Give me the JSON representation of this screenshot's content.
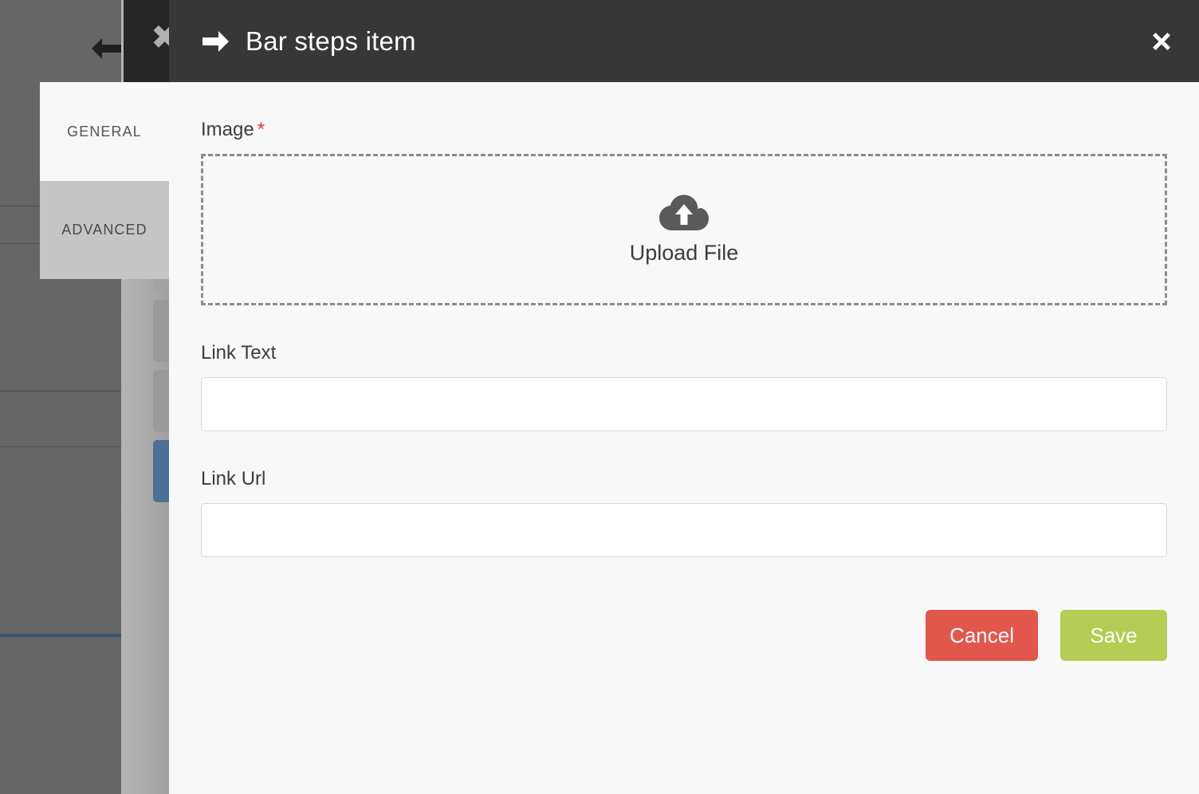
{
  "background": {
    "back_arrow_icon": "arrow-left-icon",
    "partial_glyph": "✖",
    "panel_color": "#666666",
    "strip_color": "#aaaaaa",
    "selected_chip_color": "#4d7096"
  },
  "header": {
    "title": "Bar steps item",
    "arrow_icon": "arrow-right-icon",
    "close_icon": "close-icon",
    "background_color": "#373737",
    "title_color": "#ffffff"
  },
  "tabs": [
    {
      "label": "GENERAL",
      "active": true
    },
    {
      "label": "ADVANCED",
      "active": false
    }
  ],
  "form": {
    "image": {
      "label": "Image",
      "required_marker": "*",
      "required_color": "#e8312f",
      "dropzone": {
        "text": "Upload File",
        "icon": "cloud-upload-icon",
        "border_color": "#8c8c8c"
      }
    },
    "link_text": {
      "label": "Link Text",
      "value": "",
      "placeholder": ""
    },
    "link_url": {
      "label": "Link Url",
      "value": "",
      "placeholder": ""
    }
  },
  "actions": {
    "cancel_label": "Cancel",
    "cancel_color": "#e2574c",
    "save_label": "Save",
    "save_color": "#b5cc55"
  }
}
